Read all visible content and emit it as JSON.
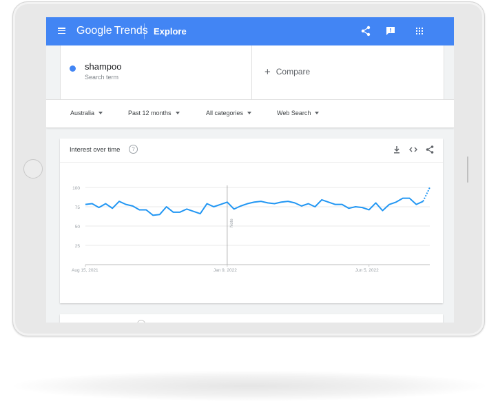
{
  "app": {
    "logo_google": "Google",
    "logo_trends": "Trends",
    "section": "Explore"
  },
  "search": {
    "term": "shampoo",
    "term_sublabel": "Search term",
    "compare_label": "Compare"
  },
  "filters": [
    {
      "label": "Australia"
    },
    {
      "label": "Past 12 months"
    },
    {
      "label": "All categories"
    },
    {
      "label": "Web Search"
    }
  ],
  "interest_card": {
    "title": "Interest over time",
    "help_glyph": "?"
  },
  "icons": {
    "menu": "hamburger-icon",
    "share": "share-icon",
    "feedback": "feedback-icon",
    "apps": "apps-grid-icon",
    "download": "download-icon",
    "embed": "embed-code-icon",
    "help": "help-circle-icon",
    "add": "plus-icon"
  },
  "colors": {
    "brand": "#4285f4",
    "series": "#2196f3",
    "grid": "#e0e0e0",
    "text_secondary": "#80868b"
  },
  "chart_data": {
    "type": "line",
    "series": [
      {
        "values": [
          78,
          79,
          74,
          79,
          73,
          82,
          78,
          76,
          71,
          71,
          64,
          65,
          75,
          68,
          68,
          72,
          69,
          66,
          79,
          75,
          78,
          81,
          72,
          76,
          79,
          81,
          82,
          80,
          79,
          81,
          82,
          80,
          76,
          79,
          75,
          84,
          81,
          78,
          78,
          73,
          75,
          74,
          71,
          80,
          70,
          78,
          81,
          86,
          86,
          78,
          82,
          100
        ],
        "partial_from_index": 50
      }
    ],
    "x_tick_labels": [
      "Aug 15, 2021",
      "Jan 9, 2022",
      "Jun 5, 2022"
    ],
    "x_tick_index": [
      0,
      21,
      42
    ],
    "y_ticks": [
      25,
      50,
      75,
      100
    ],
    "ylim": [
      0,
      100
    ],
    "grid": true,
    "annotation": {
      "label": "Note",
      "index": 21
    }
  }
}
